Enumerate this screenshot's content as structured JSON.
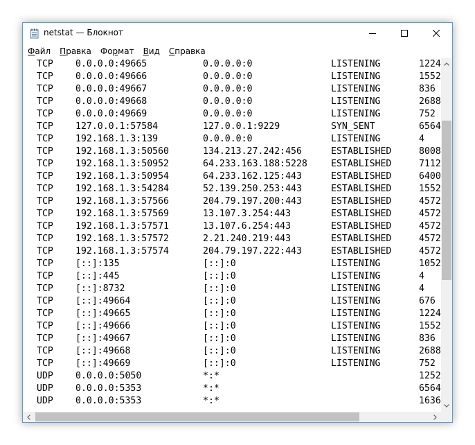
{
  "window": {
    "title": "netstat — Блокнот"
  },
  "menu": [
    {
      "pre": "",
      "acc": "Ф",
      "post": "айл"
    },
    {
      "pre": "",
      "acc": "П",
      "post": "равка"
    },
    {
      "pre": "Фо",
      "acc": "р",
      "post": "мат"
    },
    {
      "pre": "",
      "acc": "В",
      "post": "ид"
    },
    {
      "pre": "",
      "acc": "С",
      "post": "правка"
    }
  ],
  "rows": [
    [
      "TCP",
      "0.0.0.0:49665",
      "0.0.0.0:0",
      "LISTENING",
      "1224"
    ],
    [
      "TCP",
      "0.0.0.0:49666",
      "0.0.0.0:0",
      "LISTENING",
      "1552"
    ],
    [
      "TCP",
      "0.0.0.0:49667",
      "0.0.0.0:0",
      "LISTENING",
      "836"
    ],
    [
      "TCP",
      "0.0.0.0:49668",
      "0.0.0.0:0",
      "LISTENING",
      "2688"
    ],
    [
      "TCP",
      "0.0.0.0:49669",
      "0.0.0.0:0",
      "LISTENING",
      "752"
    ],
    [
      "TCP",
      "127.0.0.1:57584",
      "127.0.0.1:9229",
      "SYN_SENT",
      "6564"
    ],
    [
      "TCP",
      "192.168.1.3:139",
      "0.0.0.0:0",
      "LISTENING",
      "4"
    ],
    [
      "TCP",
      "192.168.1.3:50560",
      "134.213.27.242:456",
      "ESTABLISHED",
      "8008"
    ],
    [
      "TCP",
      "192.168.1.3:50952",
      "64.233.163.188:5228",
      "ESTABLISHED",
      "7112"
    ],
    [
      "TCP",
      "192.168.1.3:50954",
      "64.233.162.125:443",
      "ESTABLISHED",
      "6400"
    ],
    [
      "TCP",
      "192.168.1.3:54284",
      "52.139.250.253:443",
      "ESTABLISHED",
      "1552"
    ],
    [
      "TCP",
      "192.168.1.3:57566",
      "204.79.197.200:443",
      "ESTABLISHED",
      "4572"
    ],
    [
      "TCP",
      "192.168.1.3:57569",
      "13.107.3.254:443",
      "ESTABLISHED",
      "4572"
    ],
    [
      "TCP",
      "192.168.1.3:57571",
      "13.107.6.254:443",
      "ESTABLISHED",
      "4572"
    ],
    [
      "TCP",
      "192.168.1.3:57572",
      "2.21.240.219:443",
      "ESTABLISHED",
      "4572"
    ],
    [
      "TCP",
      "192.168.1.3:57574",
      "204.79.197.222:443",
      "ESTABLISHED",
      "4572"
    ],
    [
      "TCP",
      "[::]:135",
      "[::]:0",
      "LISTENING",
      "1052"
    ],
    [
      "TCP",
      "[::]:445",
      "[::]:0",
      "LISTENING",
      "4"
    ],
    [
      "TCP",
      "[::]:8732",
      "[::]:0",
      "LISTENING",
      "4"
    ],
    [
      "TCP",
      "[::]:49664",
      "[::]:0",
      "LISTENING",
      "676"
    ],
    [
      "TCP",
      "[::]:49665",
      "[::]:0",
      "LISTENING",
      "1224"
    ],
    [
      "TCP",
      "[::]:49666",
      "[::]:0",
      "LISTENING",
      "1552"
    ],
    [
      "TCP",
      "[::]:49667",
      "[::]:0",
      "LISTENING",
      "836"
    ],
    [
      "TCP",
      "[::]:49668",
      "[::]:0",
      "LISTENING",
      "2688"
    ],
    [
      "TCP",
      "[::]:49669",
      "[::]:0",
      "LISTENING",
      "752"
    ],
    [
      "UDP",
      "0.0.0.0:5050",
      "*:*",
      "",
      "1252"
    ],
    [
      "UDP",
      "0.0.0.0:5353",
      "*:*",
      "",
      "6564"
    ],
    [
      "UDP",
      "0.0.0.0:5353",
      "*:*",
      "",
      "1636"
    ]
  ]
}
